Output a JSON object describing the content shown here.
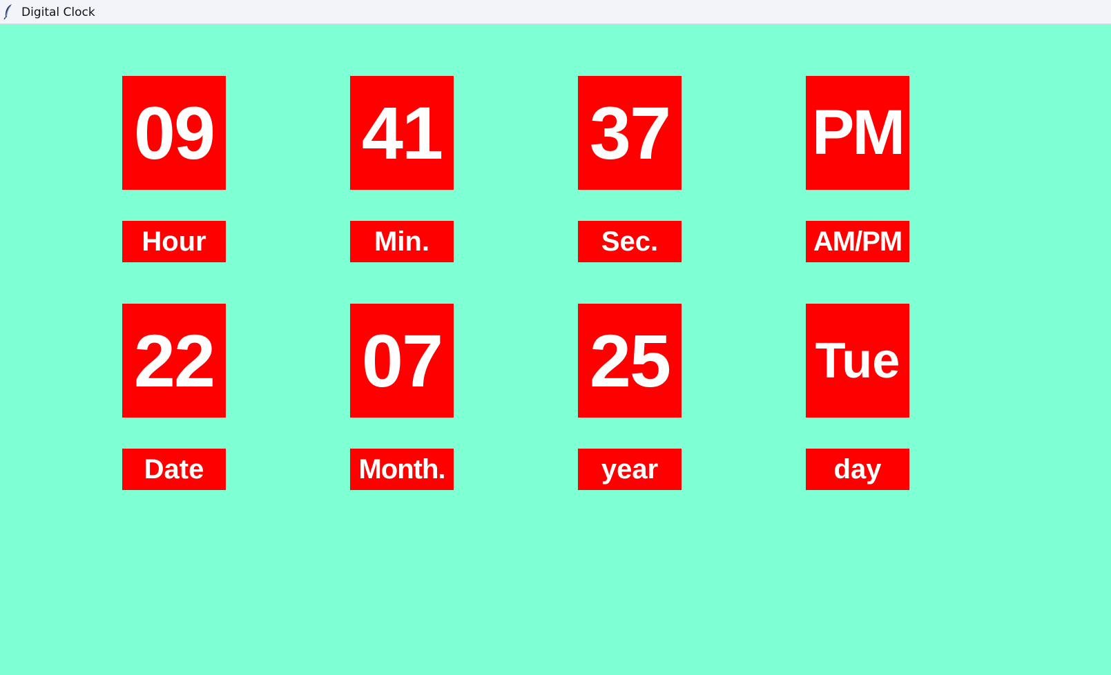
{
  "window": {
    "title": "Digital Clock",
    "icon": "feather-icon"
  },
  "colors": {
    "background": "#7fffd4",
    "box": "#ff0000",
    "text": "#ffffff"
  },
  "time": {
    "hour": "09",
    "minute": "41",
    "second": "37",
    "ampm": "PM",
    "labels": {
      "hour": "Hour",
      "minute": "Min.",
      "second": "Sec.",
      "ampm": "AM/PM"
    }
  },
  "date": {
    "date": "22",
    "month": "07",
    "year": "25",
    "day": "Tue",
    "labels": {
      "date": "Date",
      "month": "Month.",
      "year": "year",
      "day": "day"
    }
  }
}
